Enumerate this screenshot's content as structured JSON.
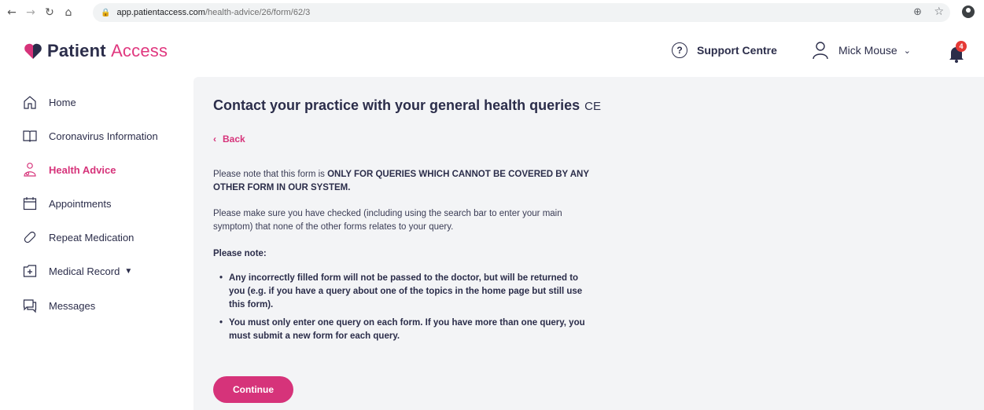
{
  "browser": {
    "url_host": "app.patientaccess.com",
    "url_path": "/health-advice/26/form/62/3"
  },
  "header": {
    "logo_part1": "Patient",
    "logo_part2": "Access",
    "support_label": "Support Centre",
    "user_name": "Mick Mouse",
    "notification_count": "4"
  },
  "sidebar": {
    "items": [
      {
        "label": "Home",
        "icon": "home-icon"
      },
      {
        "label": "Coronavirus Information",
        "icon": "book-icon"
      },
      {
        "label": "Health Advice",
        "icon": "stethoscope-icon"
      },
      {
        "label": "Appointments",
        "icon": "calendar-icon"
      },
      {
        "label": "Repeat Medication",
        "icon": "pill-icon"
      },
      {
        "label": "Medical Record",
        "icon": "medical-record-icon"
      },
      {
        "label": "Messages",
        "icon": "chat-icon"
      }
    ]
  },
  "main": {
    "title": "Contact your practice with your general health queries",
    "ce_mark": "CE",
    "back_label": "Back",
    "para1_prefix": "Please note that this form is ",
    "para1_bold": "ONLY FOR QUERIES WHICH CANNOT BE COVERED BY ANY OTHER FORM IN OUR SYSTEM.",
    "para2": "Please make sure you have checked (including using the search bar to enter your main symptom) that none of the other forms relates to your query.",
    "note_label": "Please note:",
    "bullets": [
      "Any incorrectly filled form will not be passed to the doctor, but will be returned to you (e.g. if you have a query about one of the topics in the home page but still use this form).",
      "You must only enter one query on each form. If you have more than one query, you must submit a new form for each query."
    ],
    "continue_label": "Continue"
  },
  "colors": {
    "accent": "#d6337a",
    "text": "#2b2d4a",
    "content_bg": "#f3f4f6",
    "badge": "#e53935"
  }
}
